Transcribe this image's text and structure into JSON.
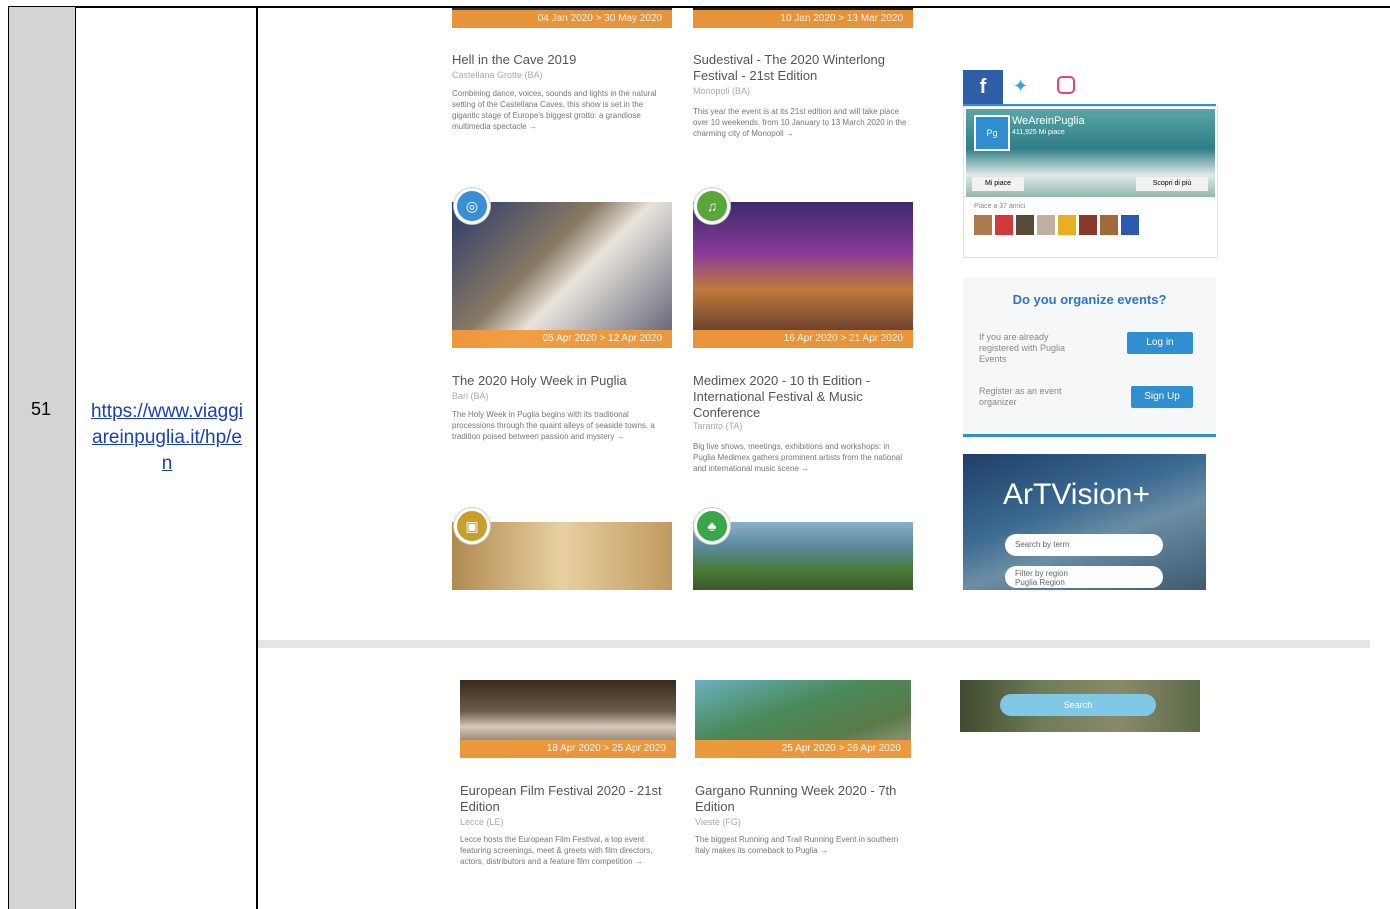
{
  "table": {
    "row_number": "51",
    "url_lines": [
      "https://www.viaggi",
      "areinpuglia.it/hp/e",
      "n"
    ]
  },
  "events": [
    {
      "title": "Hell in the Cave 2019",
      "location": "Castellana Grotte (BA)",
      "date": "04 Jan 2020 > 30 May 2020",
      "description": "Combining dance, voices, sounds and lights in the natural setting of the Castellana Caves, this show is set in the gigantic stage of Europe's biggest grotto: a grandiose multimedia spectacle →"
    },
    {
      "title": "Sudestival - The 2020 Winterlong Festival - 21st Edition",
      "location": "Monopoli (BA)",
      "date": "10 Jan 2020 > 13 Mar 2020",
      "description": "This year the event is at its 21st edition and will take place over 10 weekends, from 10 January to 13 March 2020 in the charming city of Monopoli →"
    },
    {
      "title": "The 2020 Holy Week in Puglia",
      "location": "Bari (BA)",
      "date": "05 Apr 2020 > 12 Apr 2020",
      "description": "The Holy Week in Puglia begins with its traditional processions through the quaint alleys of seaside towns, a tradition poised between passion and mystery →"
    },
    {
      "title": "Medimex 2020 - 10 th Edition - International Festival & Music Conference",
      "location": "Taranto (TA)",
      "date": "16 Apr 2020 > 21 Apr 2020",
      "description": "Big live shows, meetings, exhibitions and workshops: in Puglia Medimex gathers prominent artists from the national and international music scene →"
    },
    {
      "title": "European Film Festival 2020 - 21st Edition",
      "location": "Lecce (LE)",
      "date": "18 Apr 2020 > 25 Apr 2020",
      "description": "Lecce hosts the European Film Festival, a top event featuring screenings, meet & greets with film directors, actors, distributors and a feature film competition →"
    },
    {
      "title": "Gargano Running Week 2020 - 7th Edition",
      "location": "Vieste (FG)",
      "date": "25 Apr 2020 > 26 Apr 2020",
      "description": "The biggest Running and Trail Running Event in southern Italy makes its comeback to Puglia →"
    }
  ],
  "social": {
    "icons": [
      "facebook-icon",
      "twitter-icon",
      "instagram-icon"
    ],
    "page_name": "WeAreinPuglia",
    "likes": "411,925 Mi piace",
    "like_button": "Mi piace",
    "share_button": "Scopri di più",
    "friends_text": "Piace a 37 amici"
  },
  "organize": {
    "title": "Do you organize events?",
    "registered_text": "If you are already registered with Puglia Events",
    "login_button": "Log in",
    "register_text": "Register as an event organizer",
    "signup_button": "Sign Up"
  },
  "ad": {
    "title": "ArTVision+",
    "search_placeholder": "Search by term",
    "filter_label": "Filter by region",
    "filter_value": "Puglia Region",
    "search_button": "Search"
  },
  "colors": {
    "accent": "#f29a3b",
    "link": "#1a3fb7",
    "brand_blue": "#2f8fd1"
  }
}
